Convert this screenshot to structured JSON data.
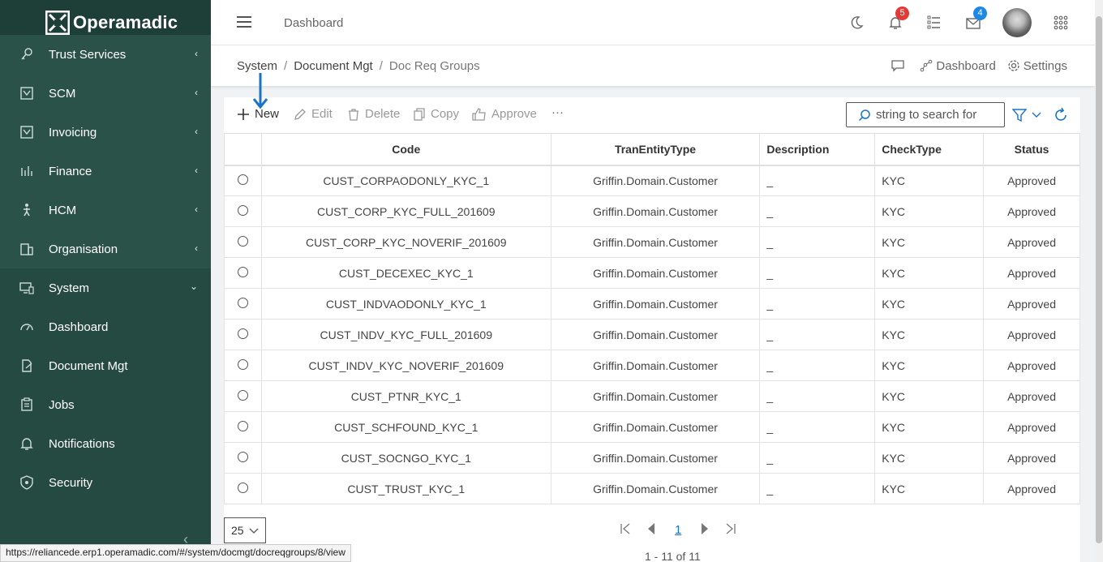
{
  "app": {
    "name": "Operamadic"
  },
  "sidebar": {
    "items": [
      {
        "label": "Trust Services",
        "icon": "key-icon",
        "has_arrow": true
      },
      {
        "label": "SCM",
        "icon": "store-icon",
        "has_arrow": true
      },
      {
        "label": "Invoicing",
        "icon": "store-icon",
        "has_arrow": true
      },
      {
        "label": "Finance",
        "icon": "chart-icon",
        "has_arrow": true
      },
      {
        "label": "HCM",
        "icon": "person-icon",
        "has_arrow": true
      },
      {
        "label": "Organisation",
        "icon": "building-icon",
        "has_arrow": true
      },
      {
        "label": "System",
        "icon": "monitor-icon",
        "has_arrow": true
      },
      {
        "label": "Dashboard",
        "icon": "gauge-icon",
        "has_arrow": false
      },
      {
        "label": "Document Mgt",
        "icon": "document-edit-icon",
        "has_arrow": false
      },
      {
        "label": "Jobs",
        "icon": "clipboard-icon",
        "has_arrow": false
      },
      {
        "label": "Notifications",
        "icon": "bell-icon",
        "has_arrow": false
      },
      {
        "label": "Security",
        "icon": "shield-icon",
        "has_arrow": false
      }
    ]
  },
  "header": {
    "title": "Dashboard",
    "notifications_count": "5",
    "messages_count": "4",
    "badge_red": "#e53935",
    "badge_blue": "#1e88e5"
  },
  "breadcrumb": {
    "items": [
      "System",
      "Document Mgt",
      "Doc Req Groups"
    ],
    "actions": {
      "dashboard": "Dashboard",
      "settings": "Settings"
    }
  },
  "toolbar": {
    "new": "New",
    "edit": "Edit",
    "delete": "Delete",
    "copy": "Copy",
    "approve": "Approve",
    "more": "···",
    "search_placeholder": "string to search for"
  },
  "table": {
    "columns": [
      "Code",
      "TranEntityType",
      "Description",
      "CheckType",
      "Status"
    ],
    "rows": [
      [
        "CUST_CORPAODONLY_KYC_1",
        "Griffin.Domain.Customer",
        "_",
        "KYC",
        "Approved"
      ],
      [
        "CUST_CORP_KYC_FULL_201609",
        "Griffin.Domain.Customer",
        "_",
        "KYC",
        "Approved"
      ],
      [
        "CUST_CORP_KYC_NOVERIF_201609",
        "Griffin.Domain.Customer",
        "_",
        "KYC",
        "Approved"
      ],
      [
        "CUST_DECEXEC_KYC_1",
        "Griffin.Domain.Customer",
        "_",
        "KYC",
        "Approved"
      ],
      [
        "CUST_INDVAODONLY_KYC_1",
        "Griffin.Domain.Customer",
        "_",
        "KYC",
        "Approved"
      ],
      [
        "CUST_INDV_KYC_FULL_201609",
        "Griffin.Domain.Customer",
        "_",
        "KYC",
        "Approved"
      ],
      [
        "CUST_INDV_KYC_NOVERIF_201609",
        "Griffin.Domain.Customer",
        "_",
        "KYC",
        "Approved"
      ],
      [
        "CUST_PTNR_KYC_1",
        "Griffin.Domain.Customer",
        "_",
        "KYC",
        "Approved"
      ],
      [
        "CUST_SCHFOUND_KYC_1",
        "Griffin.Domain.Customer",
        "_",
        "KYC",
        "Approved"
      ],
      [
        "CUST_SOCNGO_KYC_1",
        "Griffin.Domain.Customer",
        "_",
        "KYC",
        "Approved"
      ],
      [
        "CUST_TRUST_KYC_1",
        "Griffin.Domain.Customer",
        "_",
        "KYC",
        "Approved"
      ]
    ]
  },
  "pager": {
    "page_size": "25",
    "current_page": "1",
    "info": "1 - 11 of 11"
  },
  "statusbar": {
    "url": "https://reliancede.erp1.operamadic.com/#/system/docmgt/docreqgroups/8/view"
  },
  "colors": {
    "sidebar": "#254a42",
    "accent": "#1a73c8"
  }
}
